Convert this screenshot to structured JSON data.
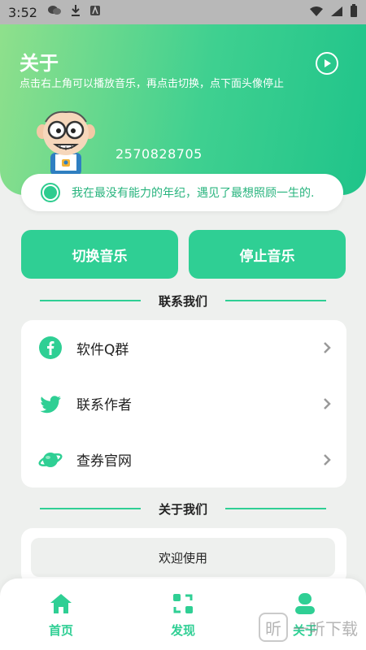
{
  "status_bar": {
    "time": "3:52",
    "icons": [
      "wechat-icon",
      "download-icon",
      "notification-a-icon",
      "wifi-icon",
      "signal-icon",
      "battery-icon"
    ]
  },
  "header": {
    "title": "关于",
    "subtitle": "点击右上角可以播放音乐，再点击切换，点下面头像停止",
    "qq_number": "2570828705"
  },
  "motto": "我在最没有能力的年纪，遇见了最想照顾一生的.",
  "actions": {
    "switch_music": "切换音乐",
    "stop_music": "停止音乐"
  },
  "contact_section": {
    "title": "联系我们",
    "items": [
      {
        "label": "软件Q群",
        "icon": "facebook-icon"
      },
      {
        "label": "联系作者",
        "icon": "twitter-icon"
      },
      {
        "label": "查券官网",
        "icon": "planet-icon"
      }
    ]
  },
  "about_section": {
    "title": "关于我们",
    "welcome": "欢迎使用"
  },
  "bottom_nav": {
    "items": [
      {
        "label": "首页",
        "icon": "home-icon"
      },
      {
        "label": "发现",
        "icon": "discover-icon"
      },
      {
        "label": "关于",
        "icon": "user-icon"
      }
    ]
  },
  "watermark": {
    "logo": "昕",
    "text": "一听下载"
  },
  "colors": {
    "accent": "#2fcf94",
    "header_gradient_start": "#8fe08c",
    "header_gradient_end": "#1fc48a",
    "background": "#eef0ee"
  }
}
